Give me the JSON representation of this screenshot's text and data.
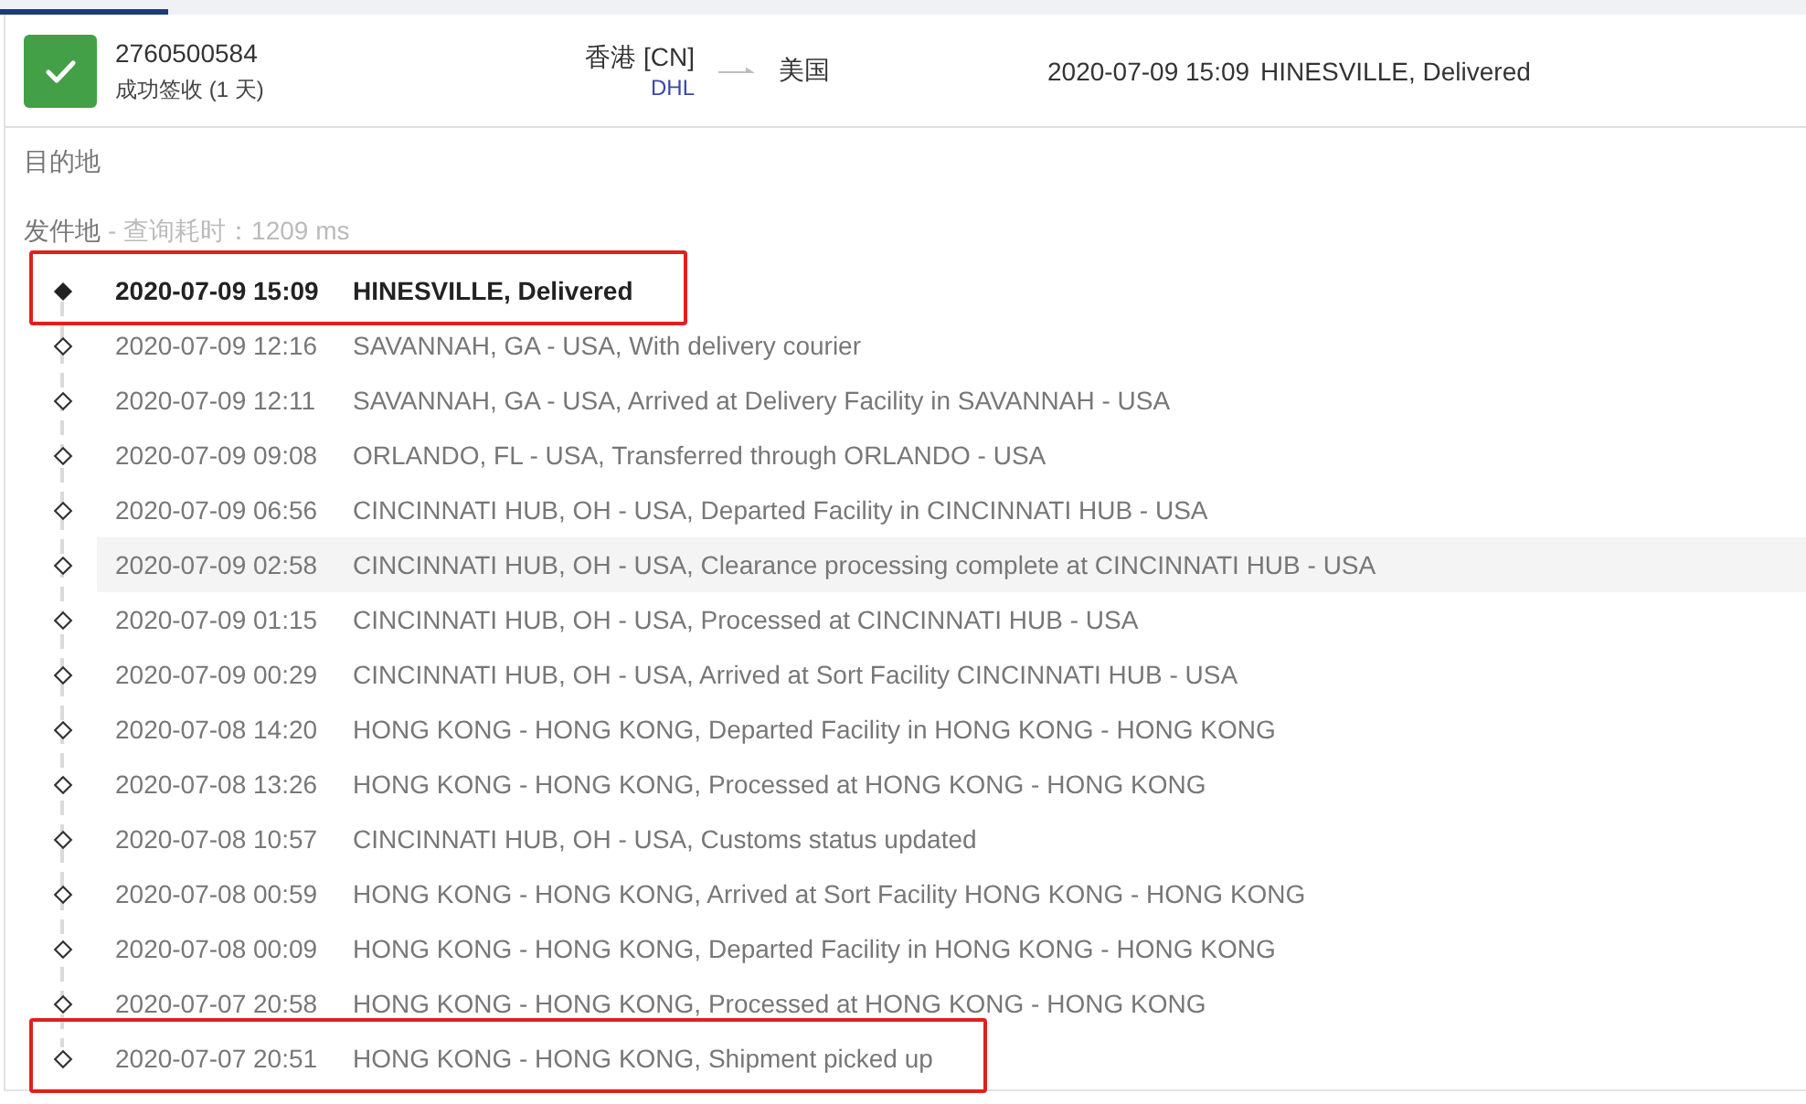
{
  "tabs": [
    {
      "selected": true
    }
  ],
  "shipment": {
    "delivered": true,
    "tracking_number": "2760500584",
    "status_text": "成功签收 (1 天)",
    "origin": "香港 [CN]",
    "carrier": "DHL",
    "destination": "美国",
    "latest_time": "2020-07-09 15:09",
    "latest_event": "HINESVILLE, Delivered"
  },
  "destination_section": {
    "label": "目的地"
  },
  "origin_section": {
    "label": "发件地",
    "query_time": "- 查询耗时：1209 ms"
  },
  "events": [
    {
      "time": "2020-07-09 15:09",
      "description": "HINESVILLE, Delivered",
      "current": true,
      "hovered": false,
      "highlighted": true
    },
    {
      "time": "2020-07-09 12:16",
      "description": "SAVANNAH, GA - USA, With delivery courier",
      "current": false,
      "hovered": false,
      "highlighted": false
    },
    {
      "time": "2020-07-09 12:11",
      "description": "SAVANNAH, GA - USA, Arrived at Delivery Facility in SAVANNAH - USA",
      "current": false,
      "hovered": false,
      "highlighted": false
    },
    {
      "time": "2020-07-09 09:08",
      "description": "ORLANDO, FL - USA, Transferred through ORLANDO - USA",
      "current": false,
      "hovered": false,
      "highlighted": false
    },
    {
      "time": "2020-07-09 06:56",
      "description": "CINCINNATI HUB, OH - USA, Departed Facility in CINCINNATI HUB - USA",
      "current": false,
      "hovered": false,
      "highlighted": false
    },
    {
      "time": "2020-07-09 02:58",
      "description": "CINCINNATI HUB, OH - USA, Clearance processing complete at CINCINNATI HUB - USA",
      "current": false,
      "hovered": true,
      "highlighted": false
    },
    {
      "time": "2020-07-09 01:15",
      "description": "CINCINNATI HUB, OH - USA, Processed at CINCINNATI HUB - USA",
      "current": false,
      "hovered": false,
      "highlighted": false
    },
    {
      "time": "2020-07-09 00:29",
      "description": "CINCINNATI HUB, OH - USA, Arrived at Sort Facility CINCINNATI HUB - USA",
      "current": false,
      "hovered": false,
      "highlighted": false
    },
    {
      "time": "2020-07-08 14:20",
      "description": "HONG KONG - HONG KONG, Departed Facility in HONG KONG - HONG KONG",
      "current": false,
      "hovered": false,
      "highlighted": false
    },
    {
      "time": "2020-07-08 13:26",
      "description": "HONG KONG - HONG KONG, Processed at HONG KONG - HONG KONG",
      "current": false,
      "hovered": false,
      "highlighted": false
    },
    {
      "time": "2020-07-08 10:57",
      "description": "CINCINNATI HUB, OH - USA, Customs status updated",
      "current": false,
      "hovered": false,
      "highlighted": false
    },
    {
      "time": "2020-07-08 00:59",
      "description": "HONG KONG - HONG KONG, Arrived at Sort Facility HONG KONG - HONG KONG",
      "current": false,
      "hovered": false,
      "highlighted": false
    },
    {
      "time": "2020-07-08 00:09",
      "description": "HONG KONG - HONG KONG, Departed Facility in HONG KONG - HONG KONG",
      "current": false,
      "hovered": false,
      "highlighted": false
    },
    {
      "time": "2020-07-07 20:58",
      "description": "HONG KONG - HONG KONG, Processed at HONG KONG - HONG KONG",
      "current": false,
      "hovered": false,
      "highlighted": false
    },
    {
      "time": "2020-07-07 20:51",
      "description": "HONG KONG - HONG KONG, Shipment picked up",
      "current": false,
      "hovered": false,
      "highlighted": true
    }
  ]
}
